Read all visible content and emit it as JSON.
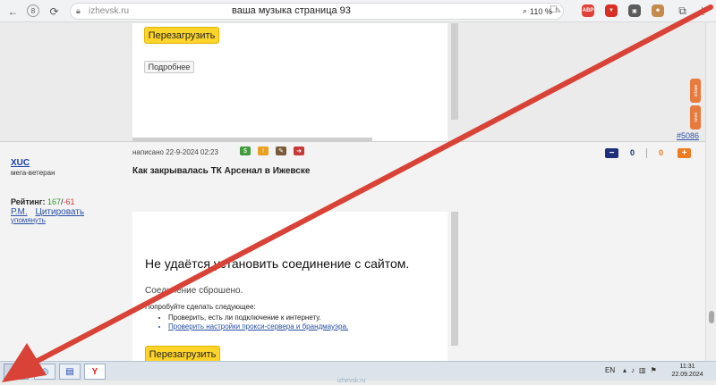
{
  "browser": {
    "domain": "izhevsk.ru",
    "page_title": "ваша музыка страница 93",
    "zoom": "110 %",
    "back_icon": "arrow-left-icon",
    "extensions": [
      {
        "label": "ABP",
        "color": "#e0413a"
      },
      {
        "label": "",
        "color": "#d93025"
      },
      {
        "label": "",
        "color": "#5b5b5b"
      },
      {
        "label": "",
        "color": "#c58b4d"
      }
    ]
  },
  "top_frame": {
    "reload_label": "Перезагрузить",
    "details_label": "Подробнее"
  },
  "page_nav": {
    "up_label": "вверх",
    "down_label": "вниз",
    "post_number": "#5086"
  },
  "post": {
    "author": "XUC",
    "rank": "мега-ветеран",
    "rating_label": "Рейтинг:",
    "rating_pos": "167",
    "rating_sep": "/",
    "rating_neg": "-61",
    "pm_link": "Р.М.",
    "quote_link": "Цитировать",
    "mention_link": "упомянуть",
    "written": "написано 22-9-2024 02:23",
    "vote_minus": "−",
    "vote_neg": "0",
    "vote_pos": "0",
    "vote_plus": "+",
    "title": "Как закрывалась ТК Арсенал в Ижевске"
  },
  "error_frame": {
    "title": "Не удаётся установить соединение с сайтом.",
    "subtitle": "Соединение сброшено.",
    "try_label": "Попробуйте сделать следующее:",
    "suggestions": [
      "Проверить, есть ли подключение к интернету.",
      "Проверить настройки прокси-сервера и брандмауэра."
    ],
    "reload_label": "Перезагрузить"
  },
  "taskbar": {
    "lang": "EN",
    "time": "11:31",
    "date": "22.09.2024",
    "watermark": "izhevsk.ru",
    "yandex_letter": "Y"
  },
  "colors": {
    "accent_button": "#fed42b",
    "annotation_arrow": "#d94236",
    "link": "#2a50a5"
  }
}
